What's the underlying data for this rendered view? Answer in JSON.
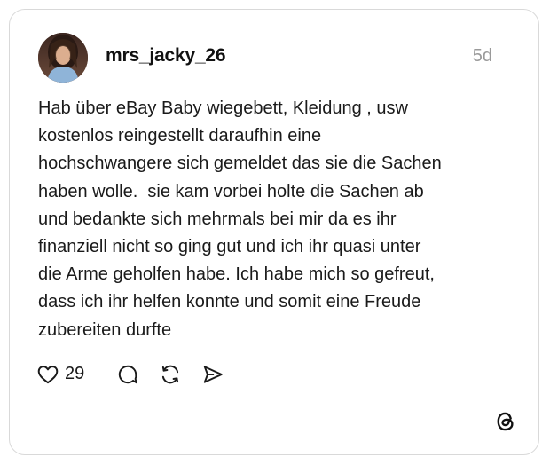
{
  "post": {
    "username": "mrs_jacky_26",
    "timestamp": "5d",
    "text": "Hab über eBay Baby wiegebett, Kleidung , usw\nkostenlos reingestellt daraufhin eine\nhochschwangere sich gemeldet das sie die Sachen\nhaben wolle.  sie kam vorbei holte die Sachen ab\nund bedankte sich mehrmals bei mir da es ihr\nfinanziell nicht so ging gut und ich ihr quasi unter\ndie Arme geholfen habe. Ich habe mich so gefreut,\ndass ich ihr helfen konnte und somit eine Freude\nzubereiten durfte",
    "like_count": "29"
  },
  "icons": {
    "like": "heart-icon",
    "comment": "comment-bubble-icon",
    "repost": "repost-icon",
    "share": "send-icon",
    "brand": "threads-logo-icon"
  },
  "colors": {
    "text": "#1a1a1a",
    "muted": "#9a9a9a",
    "border": "#d9d9d9"
  }
}
